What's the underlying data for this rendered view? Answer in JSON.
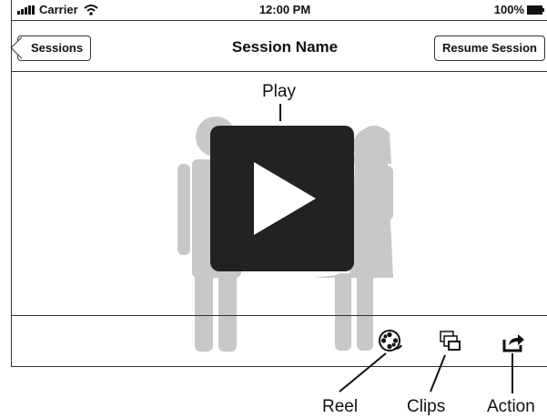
{
  "status_bar": {
    "carrier": "Carrier",
    "time": "12:00 PM",
    "battery": "100%"
  },
  "nav": {
    "back_label": "Sessions",
    "title": "Session Name",
    "resume_label": "Resume Session"
  },
  "player": {
    "play_annotation": "Play"
  },
  "toolbar": {
    "items": [
      {
        "icon": "film-reel-icon",
        "annotation": "Reel"
      },
      {
        "icon": "clips-icon",
        "annotation": "Clips"
      },
      {
        "icon": "share-action-icon",
        "annotation": "Action"
      }
    ]
  }
}
